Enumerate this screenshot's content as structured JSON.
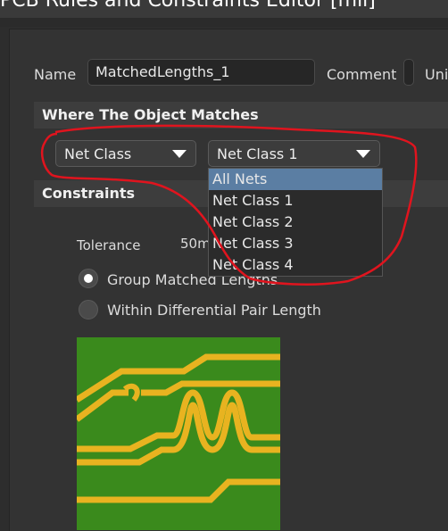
{
  "window": {
    "title": "PCB Rules and Constraints Editor [mil]"
  },
  "form": {
    "name_label": "Name",
    "name_value": "MatchedLengths_1",
    "comment_label": "Comment",
    "unique_label": "Uni"
  },
  "where_section": {
    "title": "Where The Object Matches",
    "scope_combo": "Net Class",
    "value_combo": "Net Class 1",
    "dropdown_items": [
      "All Nets",
      "Net Class 1",
      "Net Class 2",
      "Net Class 3",
      "Net Class 4"
    ],
    "selected_index": 0
  },
  "constraints_section": {
    "title": "Constraints",
    "tolerance_label": "Tolerance",
    "tolerance_value": "50m",
    "radio_group_matched": "Group Matched Lengths",
    "radio_diff_pair": "Within Differential Pair Length",
    "checked_option": "Group Matched Lengths"
  },
  "colors": {
    "selection": "#5b7ea3",
    "annotation": "#e0141e",
    "pcb_board": "#3a8a1c",
    "pcb_trace": "#e8b320"
  },
  "icons": [
    "chevron-down-icon",
    "radio-icon",
    "pcb-preview-image"
  ]
}
